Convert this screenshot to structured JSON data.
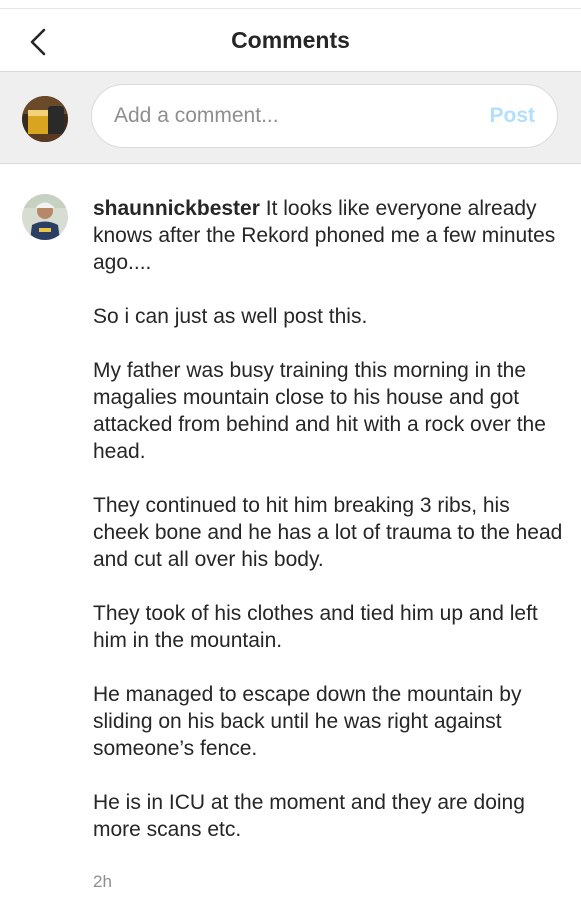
{
  "header": {
    "title": "Comments",
    "back_icon": "chevron-left-icon"
  },
  "composer": {
    "placeholder": "Add a comment...",
    "post_label": "Post",
    "post_color": "#b2dffc"
  },
  "comment": {
    "username": "shaunnickbester",
    "paragraphs": [
      "It looks like everyone already knows after the Rekord phoned me a few minutes ago....",
      "So i can just as well post this.",
      "My father was busy training this morning in the magalies mountain close to his house and got attacked from behind and hit with a rock over the head.",
      "They continued to hit him breaking 3 ribs, his cheek bone and he has a lot of trauma to the head and cut all over his body.",
      "They took of his clothes and tied him up and left him in the mountain.",
      "He managed to escape down the mountain by sliding on his back until he was right against someone’s fence.",
      "He is in ICU at the moment and they are doing more scans etc."
    ],
    "timestamp": "2h"
  },
  "colors": {
    "text": "#262626",
    "secondary_text": "#8e8e8e",
    "composer_bg": "#efefef",
    "border": "#dbdbdb"
  }
}
